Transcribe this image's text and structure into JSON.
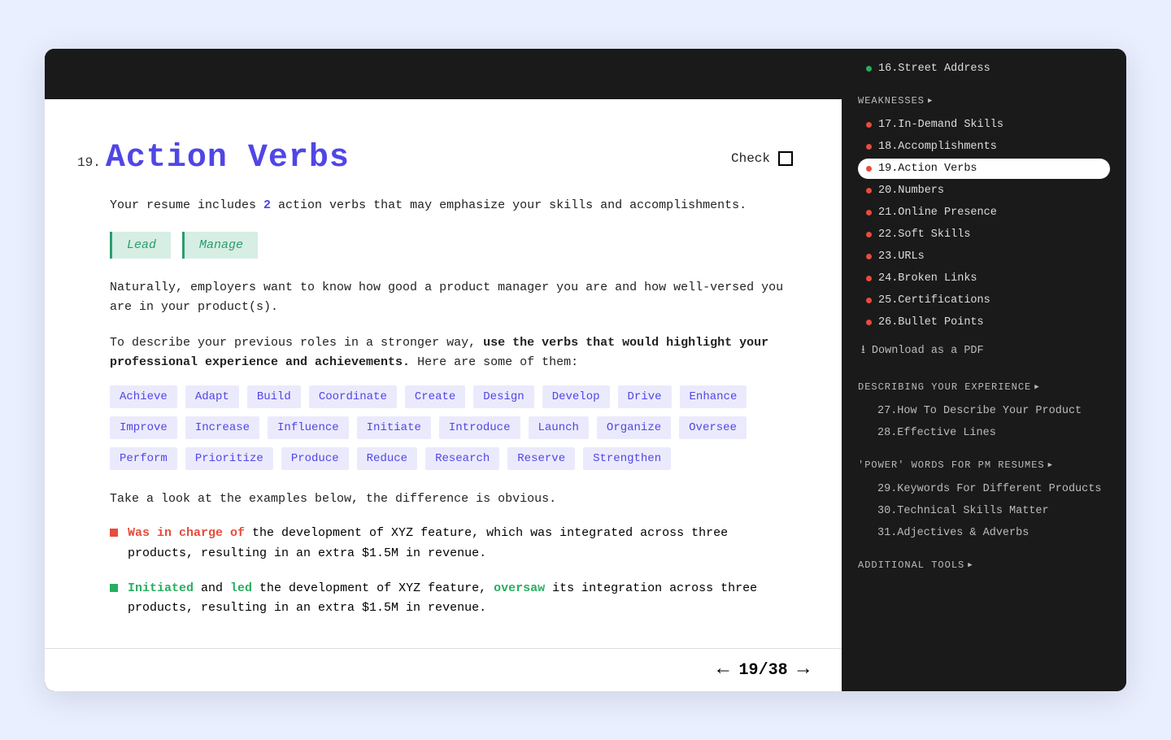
{
  "section": {
    "number": "19.",
    "title": "Action Verbs",
    "check_label": "Check",
    "intro_prefix": "Your resume includes ",
    "intro_count": "2",
    "intro_suffix": " action verbs that may emphasize your skills and accomplishments.",
    "current_verbs": [
      "Lead",
      "Manage"
    ],
    "para1": "Naturally, employers want to know how good a product manager you are and how well-versed you are in your product(s).",
    "para2_prefix": "To describe your previous roles in a stronger way, ",
    "para2_bold": "use the verbs that would highlight your professional experience and achievements.",
    "para2_suffix": " Here are some of them:",
    "suggested_verbs": [
      "Achieve",
      "Adapt",
      "Build",
      "Coordinate",
      "Create",
      "Design",
      "Develop",
      "Drive",
      "Enhance",
      "Improve",
      "Increase",
      "Influence",
      "Initiate",
      "Introduce",
      "Launch",
      "Organize",
      "Oversee",
      "Perform",
      "Prioritize",
      "Produce",
      "Reduce",
      "Research",
      "Reserve",
      "Strengthen"
    ],
    "examples_intro": "Take a look at the examples below, the difference is obvious.",
    "bad_example": {
      "highlight": "Was in charge of",
      "rest": " the development of XYZ feature, which was integrated across three products, resulting in an extra $1.5M in revenue."
    },
    "good_example": {
      "w1": "Initiated",
      "t1": " and ",
      "w2": "led",
      "t2": " the development of XYZ feature, ",
      "w3": "oversaw",
      "t3": " its integration across three products, resulting in an extra $1.5M in revenue."
    }
  },
  "pager": {
    "current": "19",
    "sep": "/",
    "total": "38"
  },
  "sidebar": {
    "top_item": {
      "dot": "green",
      "label": "16.Street Address"
    },
    "weaknesses_title": "WEAKNESSES",
    "weaknesses": [
      {
        "label": "17.In-Demand Skills",
        "active": false
      },
      {
        "label": "18.Accomplishments",
        "active": false
      },
      {
        "label": "19.Action Verbs",
        "active": true
      },
      {
        "label": "20.Numbers",
        "active": false
      },
      {
        "label": "21.Online Presence",
        "active": false
      },
      {
        "label": "22.Soft Skills",
        "active": false
      },
      {
        "label": "23.URLs",
        "active": false
      },
      {
        "label": "24.Broken Links",
        "active": false
      },
      {
        "label": "25.Certifications",
        "active": false
      },
      {
        "label": "26.Bullet Points",
        "active": false
      }
    ],
    "download_label": "Download as a PDF",
    "describing_title": "DESCRIBING YOUR EXPERIENCE",
    "describing": [
      "27.How To Describe Your Product",
      "28.Effective Lines"
    ],
    "power_title": "'POWER' WORDS FOR PM RESUMES",
    "power": [
      "29.Keywords For Different Products",
      "30.Technical Skills Matter",
      "31.Adjectives & Adverbs"
    ],
    "additional_title": "ADDITIONAL TOOLS"
  }
}
